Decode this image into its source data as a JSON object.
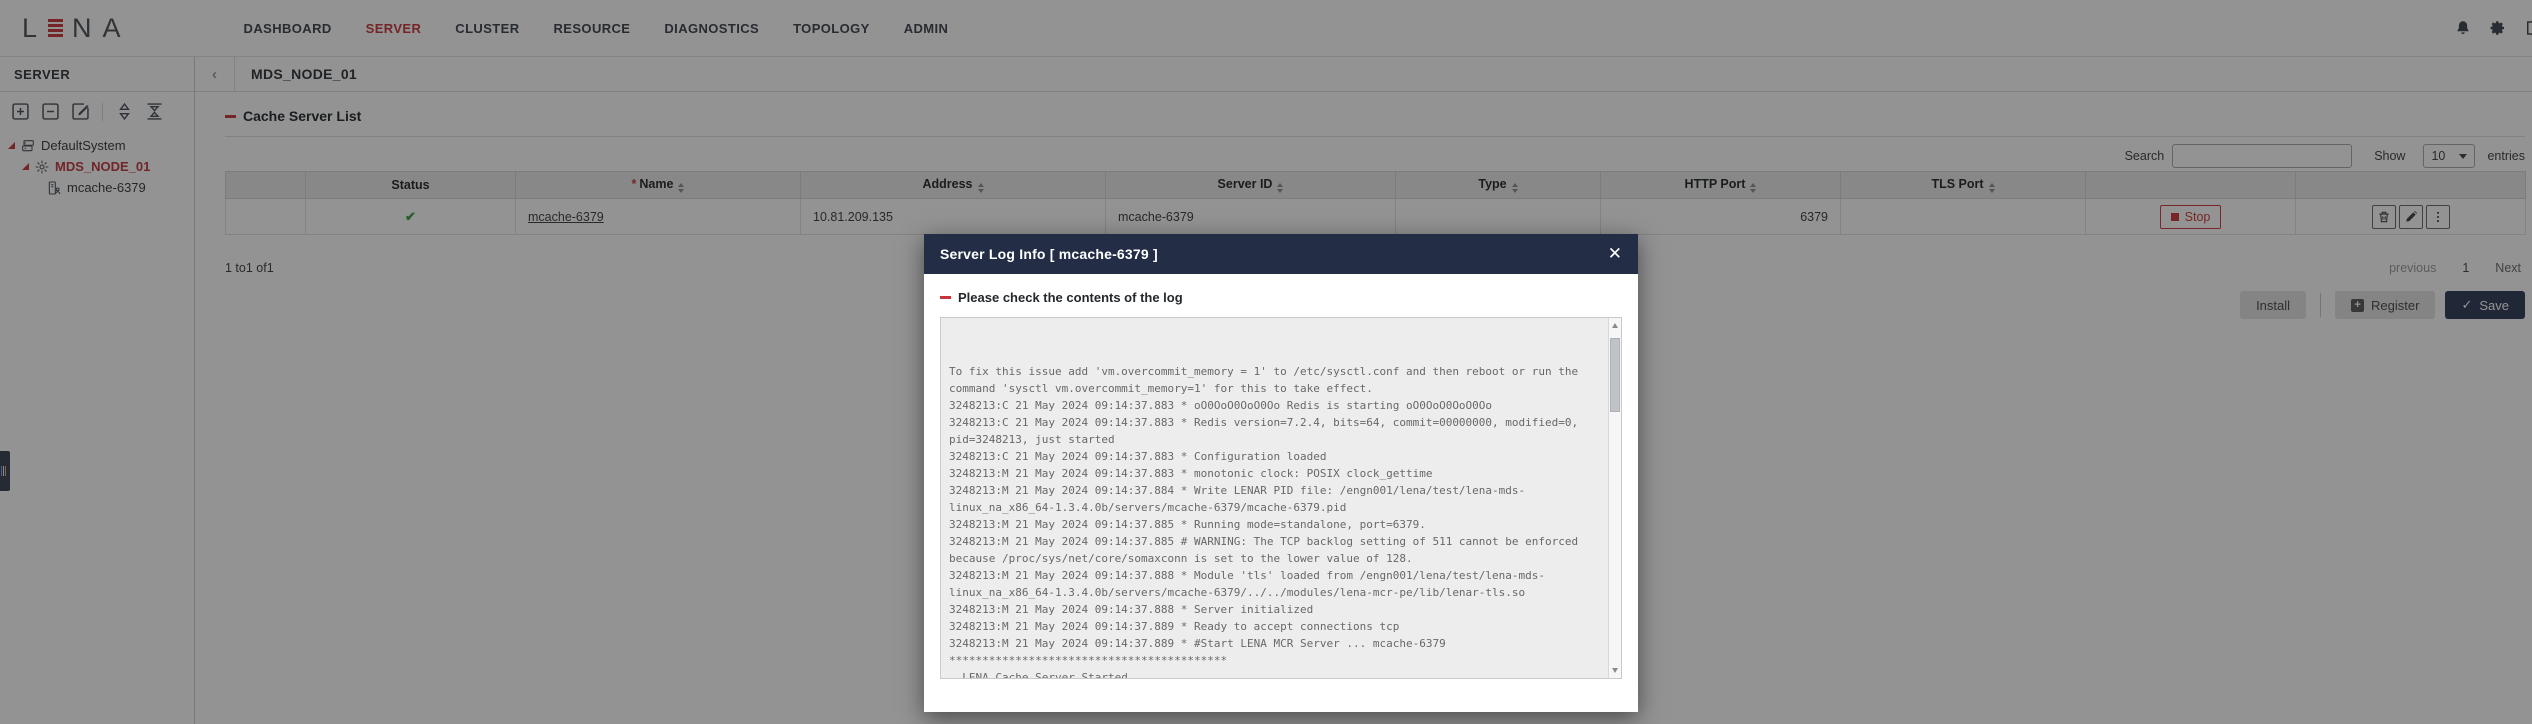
{
  "colors": {
    "accent_red": "#c8363c",
    "navy": "#232e46",
    "green": "#3fa142",
    "backdrop": "rgba(15,15,15,0.45)"
  },
  "nav": {
    "logo": {
      "l": "L",
      "n": "N",
      "a": "A"
    },
    "items": [
      {
        "label": "DASHBOARD",
        "active": false
      },
      {
        "label": "SERVER",
        "active": true
      },
      {
        "label": "CLUSTER",
        "active": false
      },
      {
        "label": "RESOURCE",
        "active": false
      },
      {
        "label": "DIAGNOSTICS",
        "active": false
      },
      {
        "label": "TOPOLOGY",
        "active": false
      },
      {
        "label": "ADMIN",
        "active": false
      }
    ],
    "icons": [
      "bell-icon",
      "gear-icon",
      "logout-icon"
    ]
  },
  "sidebar": {
    "title": "SERVER",
    "toolbar_icons": [
      "add-icon",
      "remove-icon",
      "edit-icon",
      "expand-all-icon",
      "collapse-all-icon"
    ],
    "tree": [
      {
        "label": "DefaultSystem"
      },
      {
        "label": "MDS_NODE_01"
      },
      {
        "label": "mcache-6379"
      }
    ]
  },
  "content": {
    "page_title": "MDS_NODE_01",
    "section_title": "Cache Server List",
    "controls": {
      "search_label": "Search",
      "search_value": "",
      "show_label": "Show",
      "page_size": "10",
      "entries_label": "entries"
    },
    "table": {
      "columns": [
        {
          "label": ""
        },
        {
          "label": "Status"
        },
        {
          "label": "Name",
          "required": true,
          "sortable": true
        },
        {
          "label": "Address",
          "sortable": true
        },
        {
          "label": "Server ID",
          "sortable": true
        },
        {
          "label": "Type",
          "sortable": true
        },
        {
          "label": "HTTP Port",
          "sortable": true
        },
        {
          "label": "TLS Port",
          "sortable": true
        },
        {
          "label": ""
        },
        {
          "label": ""
        }
      ],
      "rows": [
        {
          "status": "ok",
          "name": "mcache-6379",
          "address": "10.81.209.135",
          "server_id": "mcache-6379",
          "type": "",
          "http_port": "6379",
          "tls_port": "",
          "stop_label": "Stop"
        }
      ]
    },
    "pagination": {
      "info": "1 to1 of1",
      "previous": "previous",
      "page": "1",
      "next": "Next"
    },
    "buttons": {
      "install": "Install",
      "register": "Register",
      "save": "Save"
    }
  },
  "modal": {
    "title": "Server Log Info [ mcache-6379 ]",
    "subtitle": "Please check the contents of the log",
    "log_lines": [
      "To fix this issue add 'vm.overcommit_memory = 1' to /etc/sysctl.conf and then reboot or run the",
      "command 'sysctl vm.overcommit_memory=1' for this to take effect.",
      "3248213:C 21 May 2024 09:14:37.883 * oO0OoO0OoO0Oo Redis is starting oO0OoO0OoO0Oo",
      "3248213:C 21 May 2024 09:14:37.883 * Redis version=7.2.4, bits=64, commit=00000000, modified=0, pid=3248213, just started",
      "3248213:C 21 May 2024 09:14:37.883 * Configuration loaded",
      "3248213:M 21 May 2024 09:14:37.883 * monotonic clock: POSIX clock_gettime",
      "3248213:M 21 May 2024 09:14:37.884 * Write LENAR PID file: /engn001/lena/test/lena-mds-linux_na_x86_64-1.3.4.0b/servers/mcache-6379/mcache-6379.pid",
      "3248213:M 21 May 2024 09:14:37.885 * Running mode=standalone, port=6379.",
      "3248213:M 21 May 2024 09:14:37.885 # WARNING: The TCP backlog setting of 511 cannot be enforced because /proc/sys/net/core/somaxconn is set to the lower value of 128.",
      "3248213:M 21 May 2024 09:14:37.888 * Module 'tls' loaded from /engn001/lena/test/lena-mds-linux_na_x86_64-1.3.4.0b/servers/mcache-6379/../../modules/lena-mcr-pe/lib/lenar-tls.so",
      "3248213:M 21 May 2024 09:14:37.888 * Server initialized",
      "3248213:M 21 May 2024 09:14:37.889 * Ready to accept connections tcp",
      "3248213:M 21 May 2024 09:14:37.889 * #Start LENA MCR Server ... mcache-6379",
      "******************************************",
      "  LENA Cache Server Started",
      "******************************************"
    ]
  }
}
